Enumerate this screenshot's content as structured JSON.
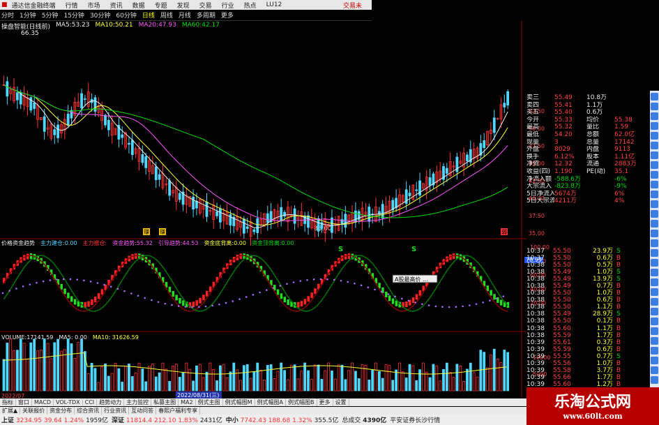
{
  "menu": {
    "title": "通达信金融终端",
    "items": [
      "行情",
      "市场",
      "资讯",
      "数据",
      "专题",
      "发现",
      "交易",
      "行业",
      "热点",
      "LU12"
    ],
    "right": "交易未"
  },
  "periods": {
    "items": [
      "分时",
      "1分钟",
      "5分钟",
      "15分钟",
      "30分钟",
      "60分钟",
      "日线",
      "周线",
      "月线",
      "多周期",
      "更多"
    ],
    "active": "日线"
  },
  "kline": {
    "label": "操盘智能(日线前)",
    "ma": [
      {
        "k": "MA5:",
        "v": "53.23",
        "c": "#eeeeee"
      },
      {
        "k": "MA10:",
        "v": "50.21",
        "c": "#ffff33"
      },
      {
        "k": "MA20:",
        "v": "47.93",
        "c": "#ff55ff"
      },
      {
        "k": "MA60:",
        "v": "42.17",
        "c": "#00dd00"
      }
    ],
    "high_marker": "66.35",
    "low_marker": "33.00",
    "yticks": [
      "52.50",
      "50.00",
      "47.50",
      "45.00",
      "42.50",
      "40.00",
      "37.50",
      "35.00"
    ],
    "bottom_tags": [
      "赚",
      "赚",
      "弱"
    ]
  },
  "osc": {
    "title": "价格资金趋势",
    "items": [
      {
        "k": "主力建仓:",
        "v": "0.00",
        "c": "#4fd7ff"
      },
      {
        "k": "主力撤仓:",
        "v": "",
        "c": "#ff3333"
      },
      {
        "k": "资金趋势:",
        "v": "55.32",
        "c": "#ff55ff"
      },
      {
        "k": "引导趋势:",
        "v": "44.53",
        "c": "#ff55ff"
      },
      {
        "k": "资金底背离:",
        "v": "0.00",
        "c": "#ffff33"
      },
      {
        "k": "资金顶背离:",
        "v": "0.00",
        "c": "#00dd00"
      }
    ],
    "yticks": [
      "100.00",
      "80.00",
      "60.00",
      "40.00",
      "20.00"
    ],
    "current": "78.99",
    "s_marks": [
      "S",
      "S"
    ],
    "tooltip": "A股最高价 ..."
  },
  "volume": {
    "label": "VOLUME:",
    "vol": "17141.59",
    "ma5": "0.00",
    "ma10": "31626.59",
    "yticks": [
      "10000",
      "5000"
    ],
    "dates": [
      "2022/07",
      "2022/08/31(三)"
    ]
  },
  "quote": {
    "rows": [
      {
        "a": "卖三",
        "b": "55.49",
        "c": "10.8万"
      },
      {
        "a": "卖四",
        "b": "55.41",
        "c": "1.1万"
      },
      {
        "a": "买五",
        "b": "55.40",
        "c": "0.6万"
      },
      {
        "a": "今开",
        "b": "55.33",
        "c": "均价",
        "d": "55.38"
      },
      {
        "a": "最高",
        "b": "55.32",
        "c": "量比",
        "d": "1.59"
      },
      {
        "a": "最低",
        "b": "54.20",
        "c": "总额",
        "d": "62.0亿"
      },
      {
        "a": "现量",
        "b": "3",
        "c": "总量",
        "d": "17142"
      },
      {
        "a": "外盘",
        "b": "8029",
        "c": "内盘",
        "d": "9113"
      },
      {
        "a": "换手",
        "b": "6.12%",
        "c": "股本",
        "d": "1.11亿"
      },
      {
        "a": "净资",
        "b": "12.32",
        "c": "流通",
        "d": "2883万"
      },
      {
        "a": "收益(四)",
        "b": "1.190",
        "c": "PE(动)",
        "d": "35.1"
      },
      {
        "a": "净流入额",
        "b": "-588.6万",
        "c": "",
        "d": "-6%"
      },
      {
        "a": "大宗流入",
        "b": "-823.8万",
        "c": "",
        "d": "-9%"
      },
      {
        "a": "5日净流入额",
        "b": "5674万",
        "c": "",
        "d": "6%"
      },
      {
        "a": "5日大宗流入",
        "b": "4211万",
        "c": "",
        "d": "4%"
      }
    ]
  },
  "ticks": {
    "rows": [
      [
        "10:37",
        "55.50",
        "23.9万",
        "S"
      ],
      [
        "10:37",
        "55.50",
        "0.6万",
        "B"
      ],
      [
        "10:38",
        "55.50",
        "0.5万",
        "B"
      ],
      [
        "10:38",
        "55.49",
        "1.0万",
        "S"
      ],
      [
        "10:38",
        "55.49",
        "13.9万",
        "S"
      ],
      [
        "10:38",
        "55.49",
        "0.7万",
        "B"
      ],
      [
        "10:38",
        "55.50",
        "1.0万",
        "B"
      ],
      [
        "10:38",
        "55.50",
        "0.6万",
        "B"
      ],
      [
        "10:38",
        "55.50",
        "1.1万",
        "B"
      ],
      [
        "10:38",
        "55.49",
        "28.9万",
        "S"
      ],
      [
        "10:38",
        "55.50",
        "0.1万",
        "B"
      ],
      [
        "10:38",
        "55.60",
        "1.1万",
        "B"
      ],
      [
        "10:38",
        "55.59",
        "1.7万",
        "B"
      ],
      [
        "10:39",
        "55.61",
        "0.3万",
        "B"
      ],
      [
        "10:39",
        "55.59",
        "0.6万",
        "B"
      ],
      [
        "10:39",
        "55.55",
        "0.7万",
        "S"
      ],
      [
        "10:39",
        "55.56",
        "1.0万",
        "B"
      ],
      [
        "10:39",
        "55.58",
        "3.7万",
        "B"
      ],
      [
        "10:39",
        "55.66",
        "1.7万",
        "B"
      ],
      [
        "10:39",
        "55.60",
        "1.2万",
        "B"
      ],
      [
        "10:40",
        "55.60",
        "0.7万",
        "S"
      ]
    ]
  },
  "tabs": [
    "指标",
    "窗口",
    "MACD",
    "VOL-TDX",
    "CCI",
    "趋势动力",
    "主力监控",
    "私募主图",
    "MA2",
    "例式主图",
    "例式幅图M",
    "例式幅图A",
    "例式幅图B",
    "更多",
    "设置"
  ],
  "tabs2": [
    "扩展▲",
    "关联报价",
    "资金分布",
    "综合资讯",
    "行业资讯",
    "互动问答",
    "春熙户福利专享"
  ],
  "status": [
    {
      "k": "上证",
      "v": "3234.95",
      "c": "39.64",
      "p": "1.24%",
      "a": "1959亿"
    },
    {
      "k": "深证",
      "v": "11814.4",
      "c": "212.10",
      "p": "1.83%",
      "a": "2431亿"
    },
    {
      "k": "中小",
      "v": "7742.43",
      "c": "188.68",
      "p": "1.32%",
      "a": "355.5亿"
    }
  ],
  "status_tail": [
    "总成交",
    "4390亿",
    "平安证券长沙行情"
  ],
  "watermark": {
    "line1": "乐淘公式网",
    "line2": "www.60lt.com"
  }
}
